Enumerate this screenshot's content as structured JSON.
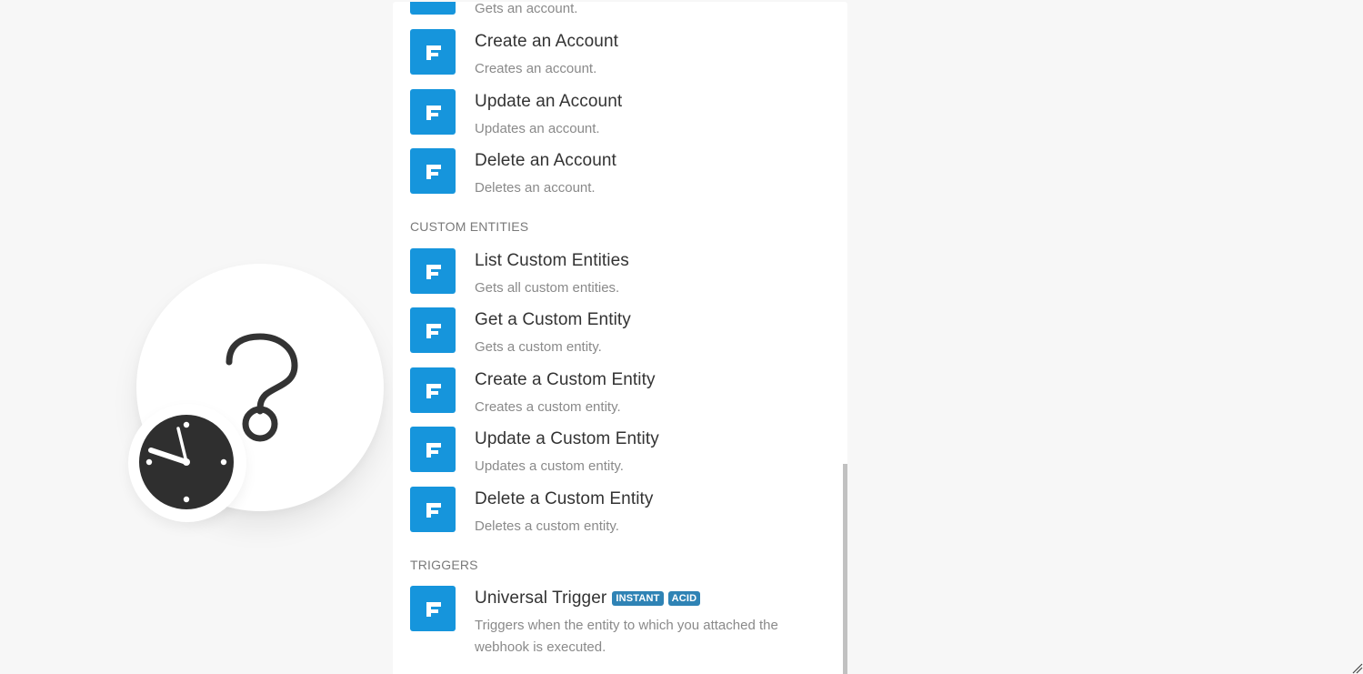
{
  "canvas": {
    "module_placeholder_icon": "question-mark-icon",
    "schedule_icon": "clock-icon"
  },
  "panel": {
    "brand_color": "#1695dc",
    "badge_color": "#2f83b5",
    "items_top": [
      {
        "title": "",
        "desc": "Gets an account."
      },
      {
        "title": "Create an Account",
        "desc": "Creates an account."
      },
      {
        "title": "Update an Account",
        "desc": "Updates an account."
      },
      {
        "title": "Delete an Account",
        "desc": "Deletes an account."
      }
    ],
    "sections": {
      "custom_entities": "CUSTOM ENTITIES",
      "triggers": "TRIGGERS"
    },
    "custom_entity_items": [
      {
        "title": "List Custom Entities",
        "desc": "Gets all custom entities."
      },
      {
        "title": "Get a Custom Entity",
        "desc": "Gets a custom entity."
      },
      {
        "title": "Create a Custom Entity",
        "desc": "Creates a custom entity."
      },
      {
        "title": "Update a Custom Entity",
        "desc": "Updates a custom entity."
      },
      {
        "title": "Delete a Custom Entity",
        "desc": "Deletes a custom entity."
      }
    ],
    "trigger_items": [
      {
        "title": "Universal Trigger",
        "badges": [
          "INSTANT",
          "ACID"
        ],
        "desc": "Triggers when the entity to which you attached the webhook is executed."
      }
    ]
  }
}
